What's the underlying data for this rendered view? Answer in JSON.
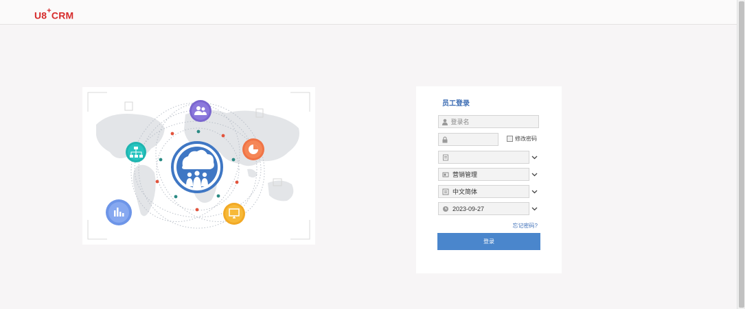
{
  "header": {
    "logo_main": "U8",
    "logo_plus": "+",
    "logo_suffix": "CRM"
  },
  "login": {
    "title": "员工登录",
    "username_placeholder": "登录名",
    "password_value": "",
    "change_password_label": "修改密码",
    "account_value": "",
    "module_value": "营销管理",
    "language_value": "中文简体",
    "date_value": "2023-09-27",
    "forgot_password": "忘记密码?",
    "login_button": "登录"
  },
  "colors": {
    "brand_red": "#d62b2b",
    "accent_blue": "#4a86cc",
    "title_blue": "#3b6cb3"
  }
}
